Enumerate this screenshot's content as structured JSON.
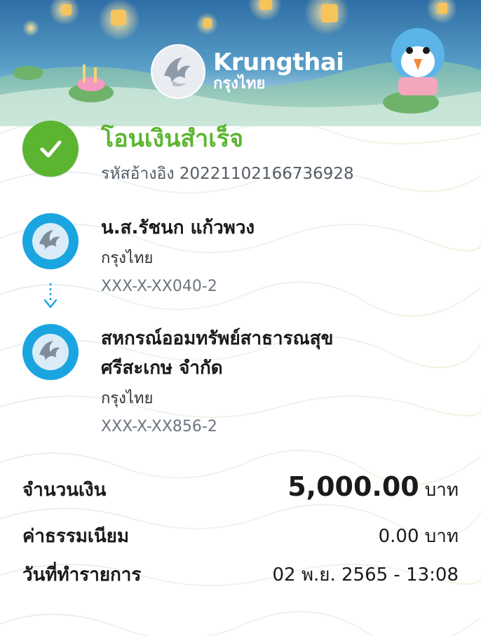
{
  "brand": {
    "name_en": "Krungthai",
    "name_th": "กรุงไทย"
  },
  "status": {
    "title": "โอนเงินสำเร็จ",
    "reference": "รหัสอ้างอิง 2022110216673692​8"
  },
  "sender": {
    "name": "น.ส.รัชนก แก้วพวง",
    "bank": "กรุงไทย",
    "account": "XXX-X-XX040-2"
  },
  "receiver": {
    "name_line1": "สหกรณ์ออมทรัพย์สาธารณสุข",
    "name_line2": "ศรีสะเกษ จำกัด",
    "bank": "กรุงไทย",
    "account": "XXX-X-XX856-2"
  },
  "summary": {
    "amount_label": "จำนวนเงิน",
    "amount_value": "5,000.00",
    "amount_unit": "บาท",
    "fee_label": "ค่าธรรมเนียม",
    "fee_value": "0.00 บาท",
    "date_label": "วันที่ทำรายการ",
    "date_value": "02 พ.ย. 2565 - 13:08"
  },
  "colors": {
    "success": "#5cb531",
    "bank_blue": "#1ba5e0",
    "secondary_text": "#555c66"
  },
  "icons": {
    "status": "check-icon",
    "bank": "krungthai-logo-icon",
    "flow": "arrow-down-icon"
  }
}
